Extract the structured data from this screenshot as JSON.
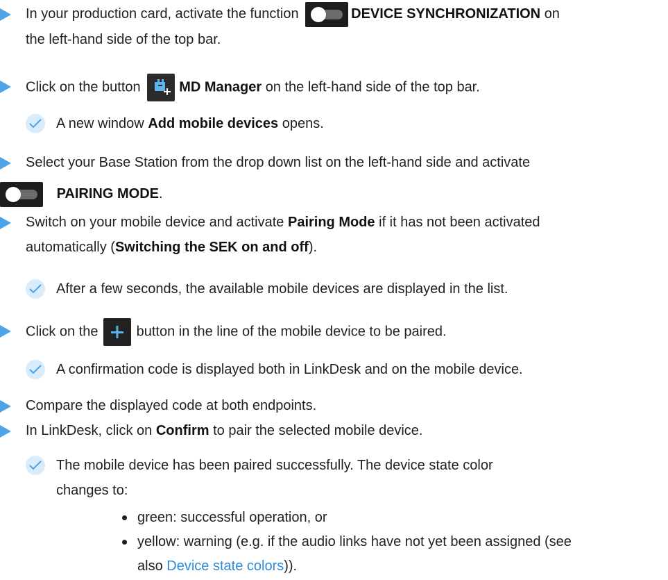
{
  "colors": {
    "accent": "#4da3e8",
    "link": "#2d8ad8",
    "check_bg": "#d8ecfb",
    "text": "#1f1f1f",
    "icon_bg": "#1d1d1d"
  },
  "steps": [
    {
      "pre": "In your production card, activate the function",
      "icon": "toggle-icon",
      "bold": "DEVICE SYNCHRONIZATION",
      "post": "on",
      "line2": "the left-hand side of the top bar."
    },
    {
      "pre": "Click on the button",
      "icon": "md-manager-icon",
      "bold": "MD Manager",
      "post": "on the left-hand side of the top bar."
    },
    {
      "pre": "Select your Base Station from the drop down list on the left-hand side and activate",
      "icon": "toggle-icon",
      "bold": "PAIRING MODE",
      "post": "."
    },
    {
      "pre": "Switch on your mobile device and activate",
      "bold": "Pairing Mode",
      "post": "if it has not been activated",
      "line2_pre": "automatically (",
      "line2_link": "Switching the SEK on and off",
      "line2_post": ")."
    },
    {
      "pre": "Click on the",
      "icon": "plus-icon",
      "post": "button in the line of the mobile device to be paired."
    },
    {
      "text": "Compare the displayed code at both endpoints."
    },
    {
      "pre": "In LinkDesk, click on",
      "bold": "Confirm",
      "post": "to pair the selected mobile device."
    }
  ],
  "results": [
    {
      "pre": "A new window",
      "bold": "Add mobile devices",
      "post": "opens."
    },
    {
      "text": "After a few seconds, the available mobile devices are displayed in the list."
    },
    {
      "text": "A confirmation code is displayed both in LinkDesk and on the mobile device."
    },
    {
      "line1": "The mobile device has been paired successfully. The device state color",
      "line2": "changes to:"
    }
  ],
  "bullets": [
    {
      "text": "green: successful operation, or"
    },
    {
      "line1": "yellow: warning (e.g. if the audio links have not yet been assigned (see",
      "line2_pre": "also",
      "line2_link": "Device state colors",
      "line2_post": "))."
    }
  ]
}
